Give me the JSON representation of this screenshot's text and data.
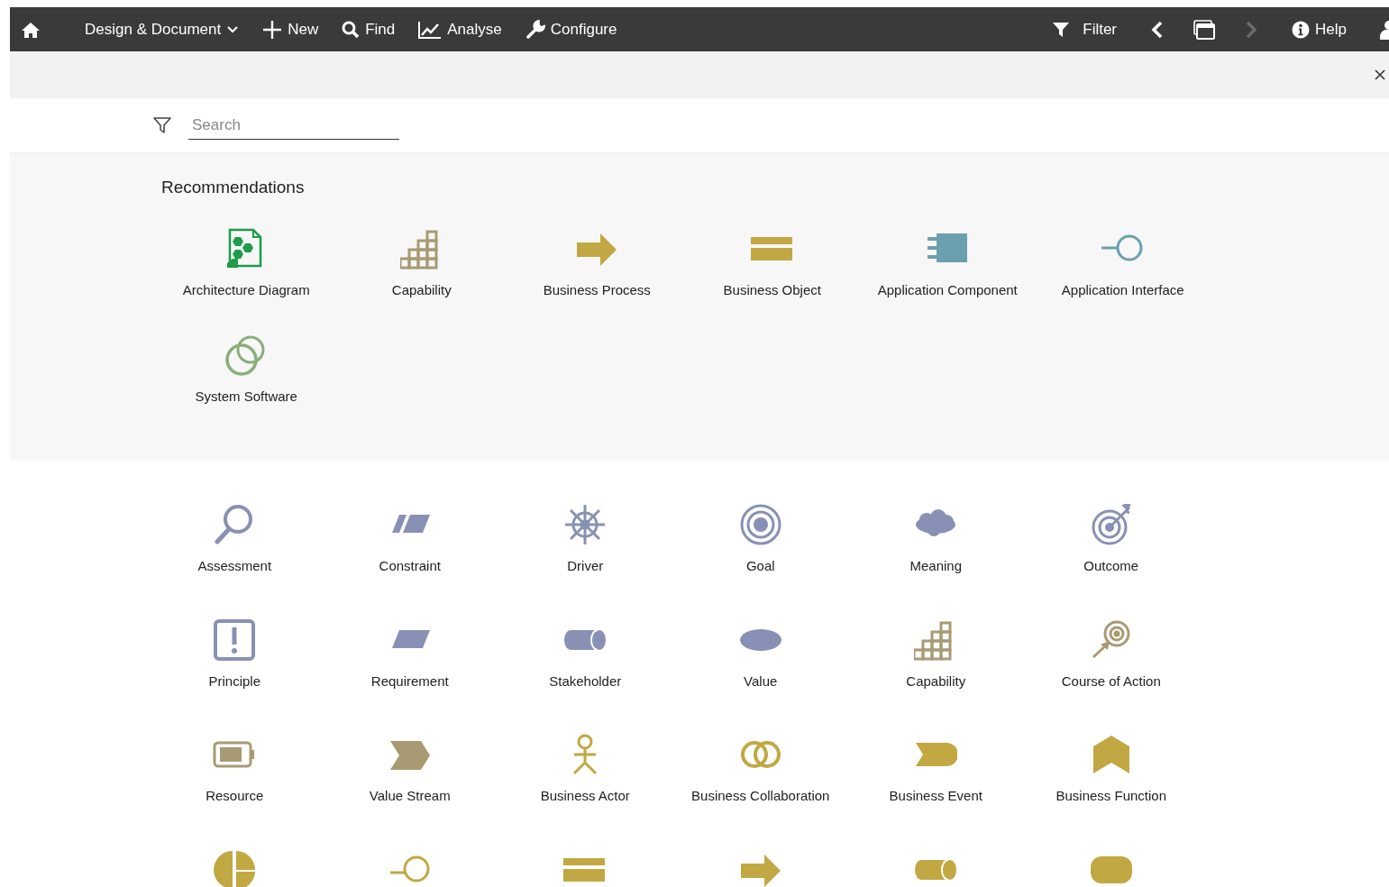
{
  "toolbar": {
    "left": [
      {
        "kind": "home"
      },
      {
        "kind": "dropdown",
        "label": "Design & Document"
      },
      {
        "kind": "plus",
        "label": "New"
      },
      {
        "kind": "search",
        "label": "Find"
      },
      {
        "kind": "chart",
        "label": "Analyse"
      },
      {
        "kind": "wrench",
        "label": "Configure"
      }
    ],
    "right": [
      {
        "kind": "filter",
        "label": "Filter"
      },
      {
        "kind": "back",
        "disabled": false
      },
      {
        "kind": "windows"
      },
      {
        "kind": "forward",
        "disabled": true
      },
      {
        "kind": "info",
        "label": "Help"
      },
      {
        "kind": "user"
      }
    ]
  },
  "search": {
    "placeholder": "Search"
  },
  "recommendations": {
    "title": "Recommendations",
    "items": [
      {
        "kind": "architecture-diagram",
        "label": "Architecture Diagram"
      },
      {
        "kind": "capability",
        "label": "Capability"
      },
      {
        "kind": "business-process",
        "label": "Business Process"
      },
      {
        "kind": "business-object",
        "label": "Business Object"
      },
      {
        "kind": "application-component",
        "label": "Application Component"
      },
      {
        "kind": "application-interface",
        "label": "Application Interface"
      },
      {
        "kind": "system-software",
        "label": "System Software"
      }
    ]
  },
  "elements": [
    {
      "kind": "assessment",
      "label": "Assessment"
    },
    {
      "kind": "constraint",
      "label": "Constraint"
    },
    {
      "kind": "driver",
      "label": "Driver"
    },
    {
      "kind": "goal",
      "label": "Goal"
    },
    {
      "kind": "meaning",
      "label": "Meaning"
    },
    {
      "kind": "outcome",
      "label": "Outcome"
    },
    {
      "kind": "principle",
      "label": "Principle"
    },
    {
      "kind": "requirement",
      "label": "Requirement"
    },
    {
      "kind": "stakeholder",
      "label": "Stakeholder"
    },
    {
      "kind": "value",
      "label": "Value"
    },
    {
      "kind": "capability",
      "label": "Capability"
    },
    {
      "kind": "course-of-action",
      "label": "Course of Action"
    },
    {
      "kind": "resource",
      "label": "Resource"
    },
    {
      "kind": "value-stream",
      "label": "Value Stream"
    },
    {
      "kind": "business-actor",
      "label": "Business Actor"
    },
    {
      "kind": "business-collaboration",
      "label": "Business Collaboration"
    },
    {
      "kind": "business-event",
      "label": "Business Event"
    },
    {
      "kind": "business-function",
      "label": "Business Function"
    },
    {
      "kind": "business-interaction"
    },
    {
      "kind": "business-interface"
    },
    {
      "kind": "business-object"
    },
    {
      "kind": "business-process"
    },
    {
      "kind": "business-role"
    },
    {
      "kind": "business-service"
    }
  ]
}
